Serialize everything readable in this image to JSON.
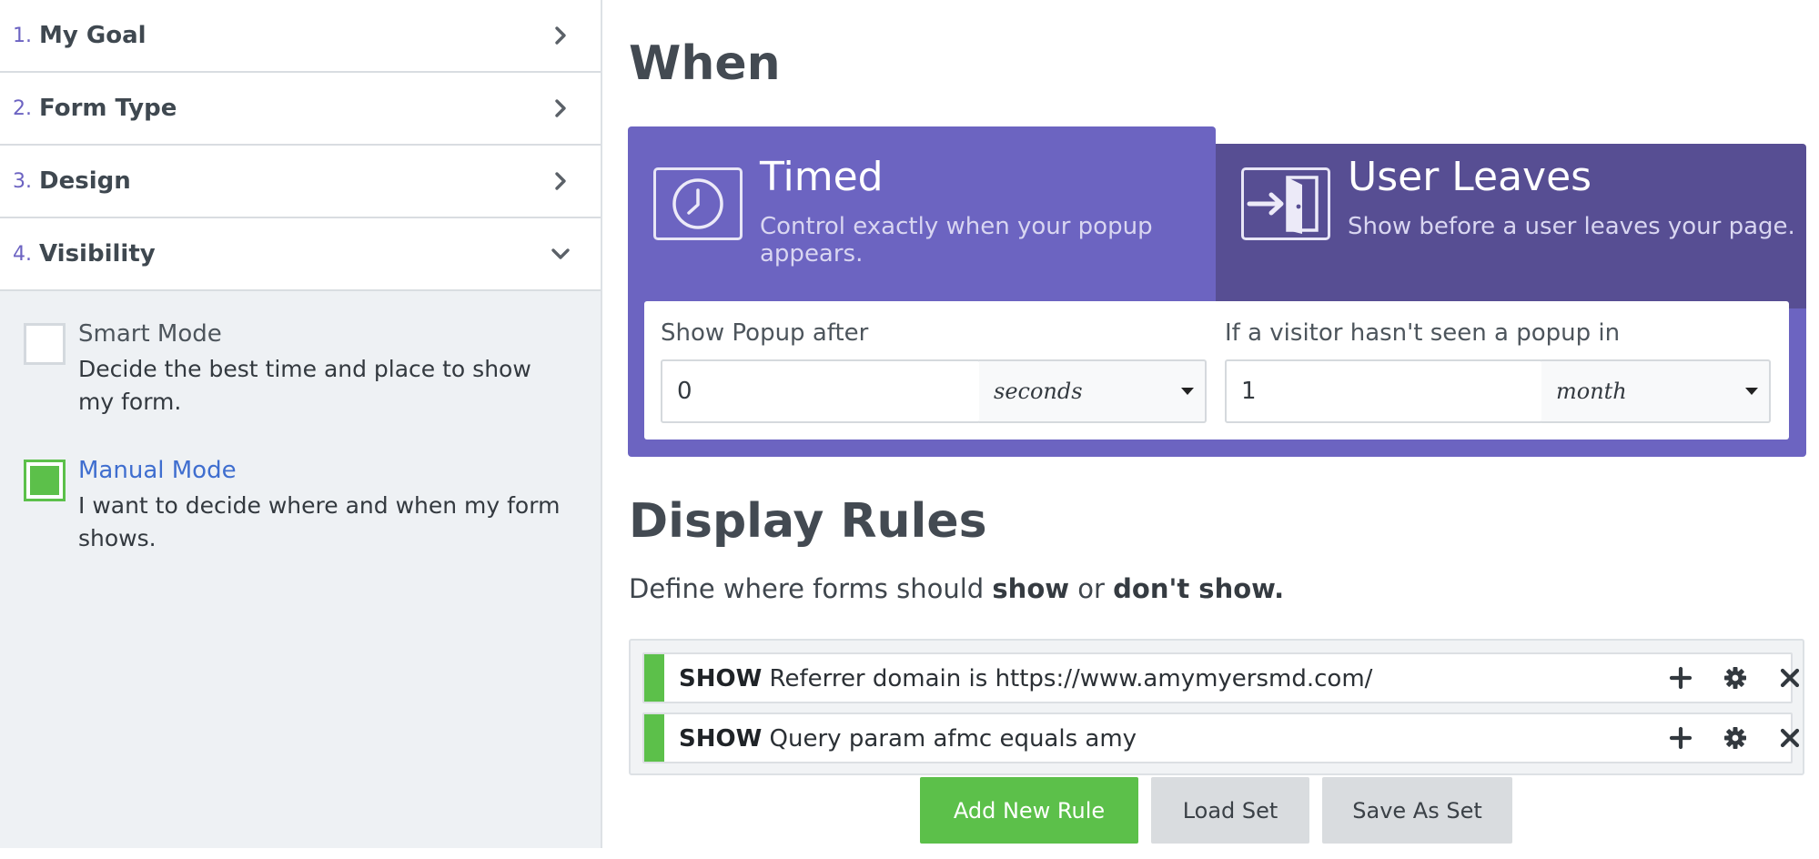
{
  "sidebar": {
    "steps": [
      {
        "num": "1.",
        "title": "My Goal",
        "expanded": false
      },
      {
        "num": "2.",
        "title": "Form Type",
        "expanded": false
      },
      {
        "num": "3.",
        "title": "Design",
        "expanded": false
      },
      {
        "num": "4.",
        "title": "Visibility",
        "expanded": true
      }
    ],
    "modes": [
      {
        "title": "Smart Mode",
        "desc": "Decide the best time and place to show my form.",
        "checked": false
      },
      {
        "title": "Manual Mode",
        "desc": "I want to decide where and when my form shows.",
        "checked": true
      }
    ]
  },
  "when": {
    "heading": "When",
    "tabs": [
      {
        "title": "Timed",
        "subtitle": "Control exactly when your popup appears.",
        "icon": "clock-icon",
        "active": true
      },
      {
        "title": "User Leaves",
        "subtitle": "Show before a user leaves your page.",
        "icon": "exit-door-icon",
        "active": false
      }
    ],
    "show_after": {
      "label": "Show Popup after",
      "value": "0",
      "unit": "seconds"
    },
    "not_seen": {
      "label": "If a visitor hasn't seen a popup in",
      "value": "1",
      "unit": "month"
    }
  },
  "display_rules": {
    "heading": "Display Rules",
    "desc_prefix": "Define where forms should ",
    "desc_show": "show",
    "desc_or": " or ",
    "desc_dont": "don't show.",
    "rules": [
      {
        "keyword": "SHOW",
        "text": "Referrer domain is https://www.amymyersmd.com/"
      },
      {
        "keyword": "SHOW",
        "text": "Query param afmc equals amy"
      }
    ],
    "buttons": {
      "add": "Add New Rule",
      "load": "Load Set",
      "save": "Save As Set"
    }
  },
  "colors": {
    "accent_purple": "#6c64c1",
    "tab_inactive": "#574e93",
    "success_green": "#5cc04a",
    "step_number": "#6c63c2"
  }
}
